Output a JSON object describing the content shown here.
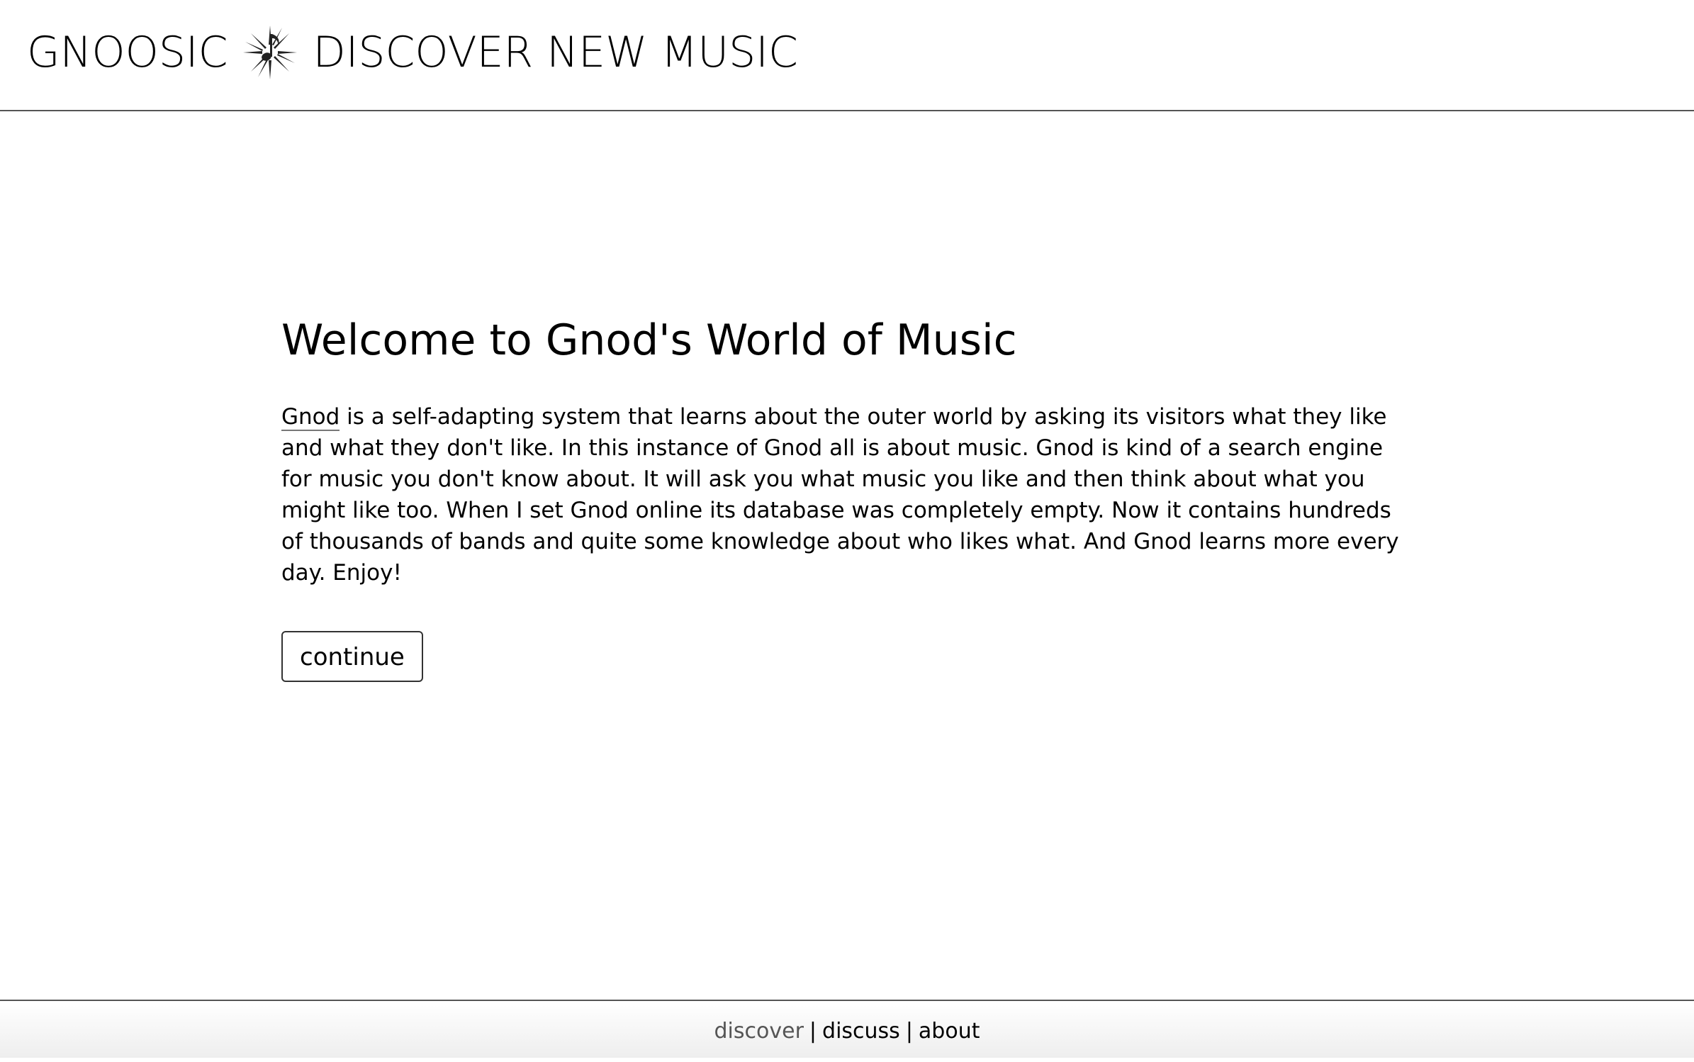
{
  "header": {
    "brand_name": "GNOOSIC",
    "tagline": "DISCOVER NEW MUSIC",
    "logo_icon": "music-note-star-icon"
  },
  "main": {
    "title": "Welcome to Gnod's World of Music",
    "intro_link": "Gnod",
    "intro_text": " is a self-adapting system that learns about the outer world by asking its visitors what they like and what they don't like. In this instance of Gnod all is about music. Gnod is kind of a search engine for music you don't know about. It will ask you what music you like and then think about what you might like too. When I set Gnod online its database was completely empty. Now it contains hundreds of thousands of bands and quite some knowledge about who likes what. And Gnod learns more every day. Enjoy!",
    "continue_label": "continue"
  },
  "footer": {
    "links": [
      {
        "label": "discover",
        "active": true
      },
      {
        "label": "discuss",
        "active": false
      },
      {
        "label": "about",
        "active": false
      }
    ],
    "separator": "|"
  }
}
